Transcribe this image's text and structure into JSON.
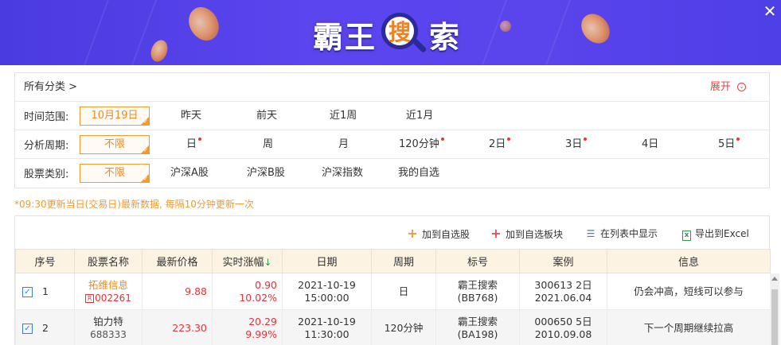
{
  "header": {
    "logo_chars": [
      "霸",
      "王",
      "搜",
      "索"
    ],
    "close_icon": "close-icon"
  },
  "filters": {
    "breadcrumb": "所有分类 >",
    "expand_label": "展开",
    "time_range": {
      "label": "时间范围:",
      "selected": "10月19日",
      "options": [
        "昨天",
        "前天",
        "近1周",
        "近1月"
      ]
    },
    "period": {
      "label": "分析周期:",
      "selected": "不限",
      "options": [
        {
          "text": "日",
          "dot": true
        },
        {
          "text": "周",
          "dot": false
        },
        {
          "text": "月",
          "dot": false
        },
        {
          "text": "120分钟",
          "dot": true
        },
        {
          "text": "2日",
          "dot": true
        },
        {
          "text": "3日",
          "dot": true
        },
        {
          "text": "4日",
          "dot": false
        },
        {
          "text": "5日",
          "dot": true
        }
      ]
    },
    "stock_type": {
      "label": "股票类别:",
      "selected": "不限",
      "options": [
        "沪深A股",
        "沪深B股",
        "沪深指数",
        "我的自选"
      ]
    }
  },
  "notice": "*09:30更新当日(交易日)最新数据, 每隔10分钟更新一次",
  "toolbar": {
    "add_watchlist": "加到自选股",
    "add_watch_block": "加到自选板块",
    "show_in_list": "在列表中显示",
    "export_excel": "导出到Excel"
  },
  "table": {
    "headers": [
      "序号",
      "股票名称",
      "最新价格",
      "实时涨幅",
      "日期",
      "周期",
      "标号",
      "案例",
      "信息"
    ],
    "rows": [
      {
        "index": "1",
        "name": "拓维信息",
        "code_badge": "R",
        "code": "002261",
        "price": "9.88",
        "change": "0.90",
        "change_pct": "10.02%",
        "date": "2021-10-19",
        "time": "15:00:00",
        "period": "日",
        "tag_name": "霸王搜索",
        "tag_code": "(BB768)",
        "case_line1": "300613 2日",
        "case_line2": "2021.06.04",
        "info": "仍会冲高，短线可以参与"
      },
      {
        "index": "2",
        "name": "铂力特",
        "code_badge": "",
        "code": "688333",
        "price": "223.30",
        "change": "20.29",
        "change_pct": "9.99%",
        "date": "2021-10-19",
        "time": "11:30:00",
        "period": "120分钟",
        "tag_name": "霸王搜索",
        "tag_code": "(BA198)",
        "case_line1": "000650 5日",
        "case_line2": "2010.09.08",
        "info": "下一个周期继续拉高"
      }
    ]
  },
  "colors": {
    "banner": "#5b45ee",
    "accent_orange": "#f39a2e",
    "up_red": "#e8303a",
    "header_bg": "#fdf3e3"
  }
}
